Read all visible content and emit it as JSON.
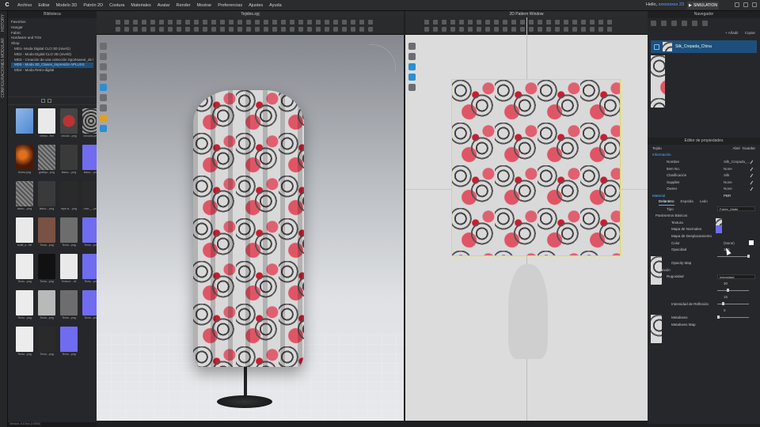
{
  "menubar": {
    "logo": "C",
    "items": [
      "Archivo",
      "Editar",
      "Modelo 3D",
      "Patrón 2D",
      "Costura",
      "Materiales",
      "Avatar",
      "Render",
      "Mostrar",
      "Preferencias",
      "Ajustes",
      "Ayuda"
    ],
    "user_greeting": "Hello,",
    "user_name": "xxxxxxxxx 23",
    "mode": "SIMULATION"
  },
  "side_tabs": [
    "HISTORY",
    "CONFIGURACIONES MODULAR"
  ],
  "library": {
    "title": "Biblioteca",
    "tree": [
      "Favoritos",
      "Hangar",
      "Fabric",
      "Hardware and Trim",
      "Shop",
      "MD1- Moda Digital CLO 3D (nivel1)",
      "MD2 - Moda Digital CLO 3D (nivel2)",
      "MD3 - Creación de una colección Sportswear_de la inspi",
      "MD5 - Moda 3D_Clases_impresión APLUSS",
      "MD4 - Moda Retro-digital"
    ],
    "tiles": [
      {
        "name": "",
        "kind": "folder"
      },
      {
        "name": "chnso...fmt",
        "kind": "doc"
      },
      {
        "name": "circulo...png",
        "kind": "red"
      },
      {
        "name": "",
        "kind": "blank"
      },
      {
        "name": "circulos.png",
        "kind": "circ"
      },
      {
        "name": "flores.png",
        "kind": "flor"
      },
      {
        "name": "grafiqu...png",
        "kind": "pattern"
      },
      {
        "name": "",
        "kind": "blank"
      },
      {
        "name": "lasso-...png",
        "kind": "shirt"
      },
      {
        "name": "lasso-...png",
        "kind": "blue"
      },
      {
        "name": "lasso-...png",
        "kind": "pattern"
      },
      {
        "name": "",
        "kind": "blank"
      },
      {
        "name": "lasso-...png",
        "kind": "shirt"
      },
      {
        "name": "rays w ...png",
        "kind": "dark"
      },
      {
        "name": "ruso _...png",
        "kind": "dark"
      },
      {
        "name": "",
        "kind": "blank"
      },
      {
        "name": "scaff_s...fdt",
        "kind": "doc"
      },
      {
        "name": "Textu...png",
        "kind": "brown"
      },
      {
        "name": "Textu...png",
        "kind": "gray"
      },
      {
        "name": "",
        "kind": "blank"
      },
      {
        "name": "Textu...png",
        "kind": "blue"
      },
      {
        "name": "Textu...png",
        "kind": "white"
      },
      {
        "name": "Textu...png",
        "kind": "black"
      },
      {
        "name": "",
        "kind": "blank"
      },
      {
        "name": "Texture ...tif",
        "kind": "doc"
      },
      {
        "name": "Textu...png",
        "kind": "blue"
      },
      {
        "name": "Textu...png",
        "kind": "white"
      },
      {
        "name": "",
        "kind": "blank"
      },
      {
        "name": "Textu...png",
        "kind": "lightgray"
      },
      {
        "name": "Textu...png",
        "kind": "gray"
      },
      {
        "name": "Textu...png",
        "kind": "blue"
      },
      {
        "name": "",
        "kind": "blank"
      },
      {
        "name": "Textu...png",
        "kind": "white"
      },
      {
        "name": "Textu...png",
        "kind": "dark"
      },
      {
        "name": "Textu...png",
        "kind": "blue"
      },
      {
        "name": "",
        "kind": "blank"
      }
    ],
    "status": "Version: 6.0.5xx (r.0000)"
  },
  "viewport3d": {
    "title": "Tejidos.zpj"
  },
  "viewport2d": {
    "title": "2D Pattern Window"
  },
  "navigator": {
    "title": "Navegador",
    "add": "+ Añadir",
    "copy": "Copiar",
    "fabric_name": "Silk_Crepada_China"
  },
  "properties": {
    "title": "Editor de propiedades",
    "header_tejido": "Tejido",
    "btn_abrir": "Abrir",
    "btn_guardar": "Guardar",
    "info_section": "Información",
    "nombre_label": "Nombre",
    "nombre_val": "Silk_Crepada_...",
    "item_label": "Item No.",
    "item_val": "None",
    "clas_label": "Clasificación",
    "clas_val": "Silk",
    "supplier_label": "Supplier",
    "supplier_val": "None",
    "owner_label": "Owner",
    "owner_val": "None",
    "material_section": "Material",
    "material_val": "PBR",
    "tabs": [
      "Delantero",
      "Espalda",
      "Lado"
    ],
    "tipo_label": "Tipo",
    "tipo_val": "Fabric_Matte",
    "basic_params": "Parámetros Básicos",
    "textura": "Textura",
    "mapa_normales": "Mapa de Normales",
    "mapa_desp": "Mapa de Desplazamiento",
    "color_label": "Color",
    "color_val": "(None)",
    "opacidad_label": "Opacidad",
    "opacidad_val": "100",
    "opacity_map": "Opacity Map",
    "reflexion": "Reflexión",
    "rugosidad_label": "Rugosidad",
    "rugosidad_val": "Intensidad",
    "rug_num": "30",
    "intensidad_label": "Intensidad de Reflexión",
    "intensidad_val": "15",
    "metalness_label": "Metalness",
    "metalness_val": "0",
    "metalness_map": "Metalness Map"
  },
  "colors": {
    "accent": "#5aa9ff",
    "selection": "#1d4f7c",
    "cloth_red": "#e05565",
    "cloth_dark": "#444444"
  }
}
